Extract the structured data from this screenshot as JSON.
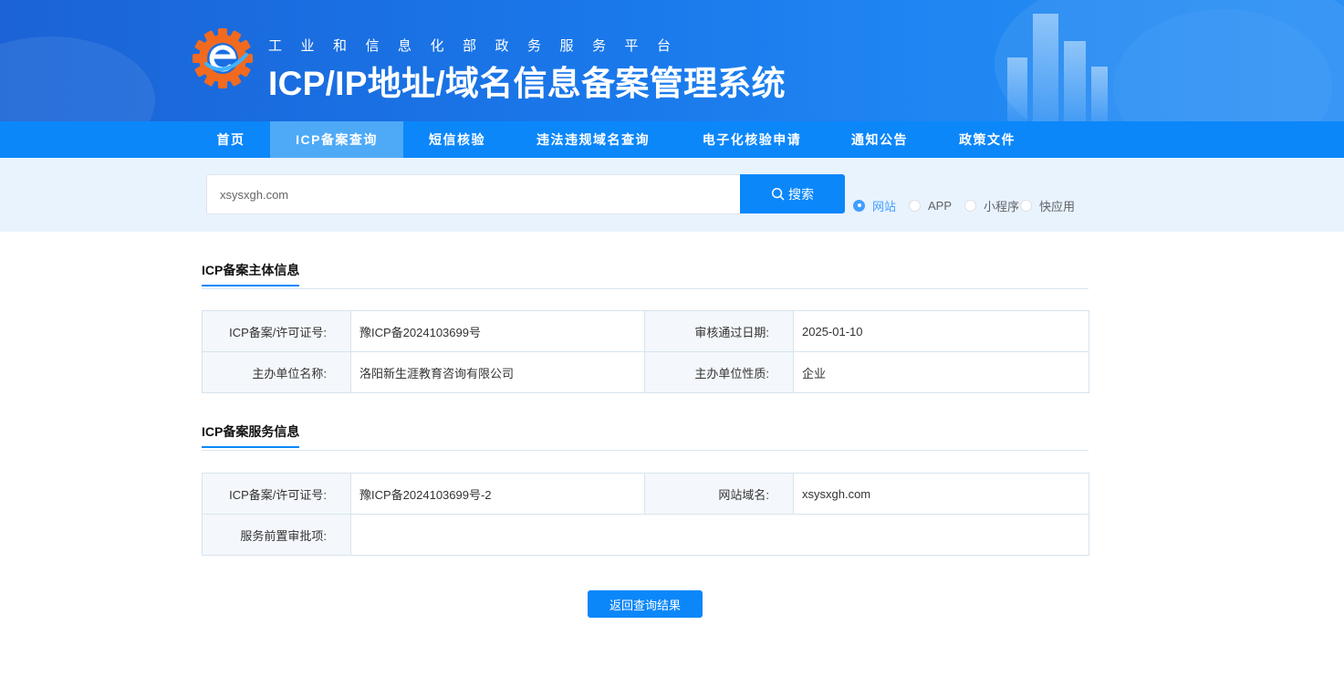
{
  "header": {
    "subtitle": "工业和信息化部政务服务平台",
    "title": "ICP/IP地址/域名信息备案管理系统",
    "logo_icon": "gear-e-logo-icon"
  },
  "nav": {
    "items": [
      {
        "label": "首页",
        "active": false
      },
      {
        "label": "ICP备案查询",
        "active": true
      },
      {
        "label": "短信核验",
        "active": false
      },
      {
        "label": "违法违规域名查询",
        "active": false
      },
      {
        "label": "电子化核验申请",
        "active": false
      },
      {
        "label": "通知公告",
        "active": false
      },
      {
        "label": "政策文件",
        "active": false
      }
    ]
  },
  "search": {
    "value": "xsysxgh.com",
    "button_label": "搜索",
    "button_icon": "search-icon",
    "types": [
      {
        "label": "网站",
        "checked": true
      },
      {
        "label": "APP",
        "checked": false
      },
      {
        "label": "小程序",
        "checked": false
      },
      {
        "label": "快应用",
        "checked": false
      }
    ]
  },
  "subject_info": {
    "title": "ICP备案主体信息",
    "rows": [
      [
        {
          "label": "ICP备案/许可证号:",
          "value": "豫ICP备2024103699号"
        },
        {
          "label": "审核通过日期:",
          "value": "2025-01-10"
        }
      ],
      [
        {
          "label": "主办单位名称:",
          "value": "洛阳新生涯教育咨询有限公司"
        },
        {
          "label": "主办单位性质:",
          "value": "企业"
        }
      ]
    ]
  },
  "service_info": {
    "title": "ICP备案服务信息",
    "license_label": "ICP备案/许可证号:",
    "license_value": "豫ICP备2024103699号-2",
    "domain_label": "网站域名:",
    "domain_value": "xsysxgh.com",
    "approval_label": "服务前置审批项:",
    "approval_value": ""
  },
  "back_button": "返回查询结果",
  "colors": {
    "primary": "#0b87fa",
    "nav_active": "#4eaaf7",
    "radio_checked": "#409eff",
    "search_band": "#e9f3fe"
  }
}
